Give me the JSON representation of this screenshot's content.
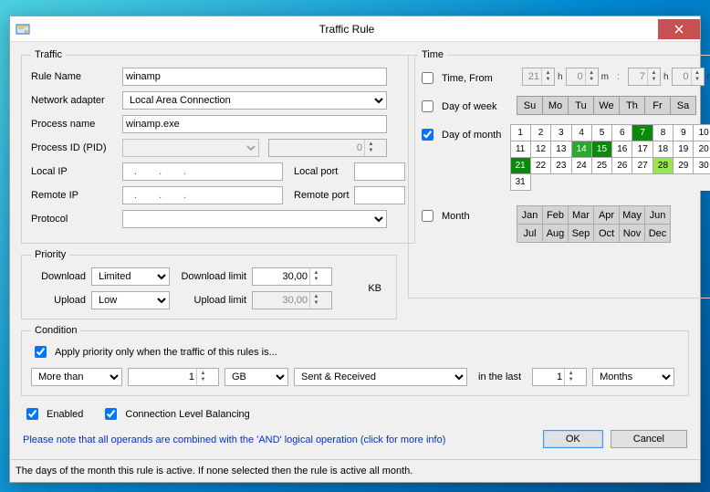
{
  "title": "Traffic Rule",
  "traffic": {
    "legend": "Traffic",
    "rule_name_lbl": "Rule Name",
    "rule_name": "winamp",
    "net_adapter_lbl": "Network adapter",
    "net_adapter": "Local Area Connection",
    "proc_name_lbl": "Process name",
    "proc_name": "winamp.exe",
    "pid_lbl": "Process ID (PID)",
    "pid_sel": "",
    "pid_val": "0",
    "local_ip_lbl": "Local IP",
    "local_port_lbl": "Local port",
    "remote_ip_lbl": "Remote IP",
    "remote_port_lbl": "Remote port",
    "protocol_lbl": "Protocol",
    "protocol": ""
  },
  "priority": {
    "legend": "Priority",
    "dl_lbl": "Download",
    "dl_val": "Limited",
    "ul_lbl": "Upload",
    "ul_val": "Low",
    "dl_limit_lbl": "Download limit",
    "dl_limit": "30,00",
    "ul_limit_lbl": "Upload limit",
    "ul_limit": "30,00",
    "unit": "KB"
  },
  "time": {
    "legend": "Time",
    "time_from_lbl": "Time, From",
    "time_from_checked": false,
    "from_h": "21",
    "from_m": "0",
    "to_h": "7",
    "to_m": "0",
    "dow_lbl": "Day of week",
    "dow_checked": false,
    "dow": [
      "Su",
      "Mo",
      "Tu",
      "We",
      "Th",
      "Fr",
      "Sa"
    ],
    "dom_lbl": "Day of month",
    "dom_checked": true,
    "month_lbl": "Month",
    "month_checked": false,
    "months": [
      "Jan",
      "Feb",
      "Mar",
      "Apr",
      "May",
      "Jun",
      "Jul",
      "Aug",
      "Sep",
      "Oct",
      "Nov",
      "Dec"
    ],
    "days_sel_dark": [
      7,
      15,
      21
    ],
    "days_sel_med": [
      14
    ],
    "days_sel_light": [
      28
    ]
  },
  "condition": {
    "legend": "Condition",
    "apply_label": "Apply priority only when the traffic of this rules is...",
    "apply_checked": true,
    "op": "More than",
    "amount": "1",
    "unit": "GB",
    "direction": "Sent & Received",
    "inlast_lbl": "in the last",
    "inlast_val": "1",
    "inlast_unit": "Months"
  },
  "bottom": {
    "enabled_lbl": "Enabled",
    "enabled": true,
    "clb_lbl": "Connection Level Balancing",
    "clb": true
  },
  "note": "Please note that all operands are combined with the 'AND' logical operation (click for more info)",
  "buttons": {
    "ok": "OK",
    "cancel": "Cancel"
  },
  "status": "The days of the month this rule is active. If none selected then the rule is active all month.",
  "h_unit": "h",
  "m_unit": "m"
}
